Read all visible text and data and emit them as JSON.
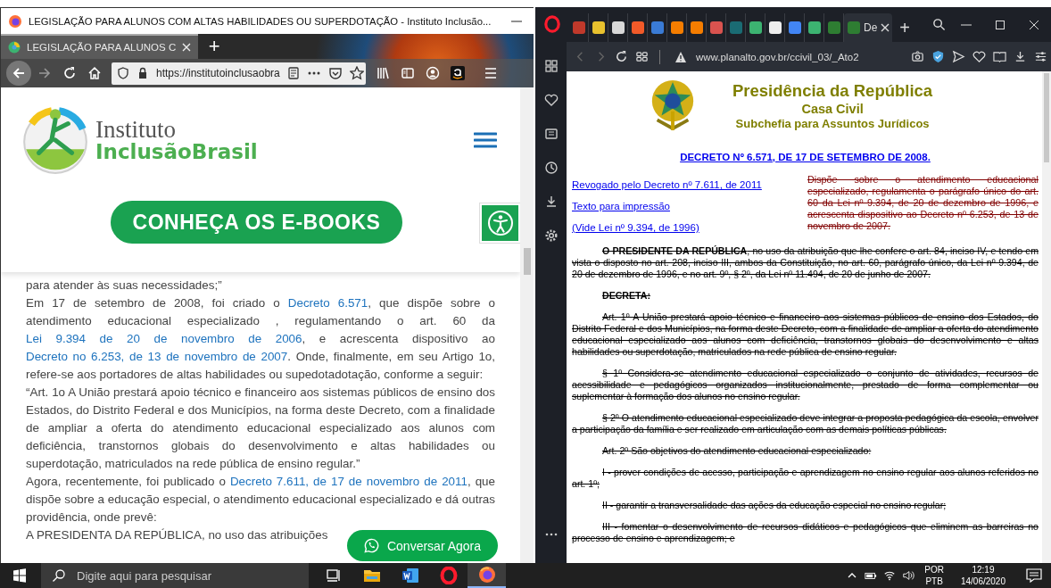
{
  "firefox": {
    "window_title": "LEGISLAÇÃO PARA ALUNOS COM ALTAS HABILIDADES OU SUPERDOTAÇÃO - Instituto Inclusão...",
    "tabs": [
      {
        "title": "LEGISLAÇÃO PARA ALUNOS C",
        "selected": true
      }
    ],
    "new_tab": "+",
    "url": "https://institutoinclusaobra",
    "site": {
      "logo_top": "Instituto",
      "logo_bottom": "InclusãoBrasil",
      "cta": "CONHEÇA OS E-BOOKS",
      "chat_button": "Conversar Agora",
      "paragraphs": [
        {
          "segments": [
            {
              "kind": "text",
              "text": "para atender às suas necessidades;”"
            }
          ]
        },
        {
          "segments": [
            {
              "kind": "text",
              "text": "Em 17 de setembro de 2008, foi criado o "
            },
            {
              "kind": "link",
              "text": "Decreto 6.571"
            },
            {
              "kind": "text",
              "text": ", que dispõe sobre o atendimento educacional especializado , regulamentando o art. 60 da "
            },
            {
              "kind": "link",
              "text": "Lei 9.394 de 20 de novembro de 2006"
            },
            {
              "kind": "text",
              "text": ", e acrescenta dispositivo ao "
            },
            {
              "kind": "link",
              "text": "Decreto no 6.253, de 13 de novembro de 2007"
            },
            {
              "kind": "text",
              "text": ". Onde, finalmente, em seu Artigo 1o, refere-se aos portadores de altas habilidades ou supedotadotação, conforme a seguir:"
            }
          ]
        },
        {
          "segments": [
            {
              "kind": "text",
              "text": "“Art. 1o A União prestará apoio técnico e financeiro aos sistemas públicos de ensino dos Estados, do Distrito Federal e dos Municípios, na forma deste Decreto, com a finalidade de ampliar a oferta do atendimento educacional especializado aos alunos com deficiência, transtornos globais do desenvolvimento e altas habilidades ou superdotação, matriculados na rede pública de ensino regular.”"
            }
          ]
        },
        {
          "segments": [
            {
              "kind": "text",
              "text": "Agora, recentemente, foi publicado o "
            },
            {
              "kind": "link",
              "text": "Decreto 7.611, de 17 de novembro de 2011"
            },
            {
              "kind": "text",
              "text": ", que dispõe sobre a educação especial, o atendimento educacional especializado e dá outras providência, onde prevê:"
            }
          ]
        },
        {
          "segments": [
            {
              "kind": "text",
              "text": "A PRESIDENTA DA REPÚBLICA, no uso das atribuições"
            }
          ]
        }
      ]
    }
  },
  "opera": {
    "tabs": [
      {
        "color": "#c0392b",
        "selected": false
      },
      {
        "color": "#e8c12e",
        "selected": false
      },
      {
        "color": "#d8d8d8",
        "selected": false
      },
      {
        "color": "#f15a29",
        "selected": false
      },
      {
        "color": "#3a7bd5",
        "selected": false
      },
      {
        "color": "#f57d00",
        "selected": false
      },
      {
        "color": "#f57d00",
        "selected": false
      },
      {
        "color": "#d9534f",
        "selected": false
      },
      {
        "color": "#1a6b73",
        "selected": false
      },
      {
        "color": "#3cb371",
        "selected": false
      },
      {
        "color": "#eeeeee",
        "selected": false
      },
      {
        "color": "#4285f4",
        "selected": false
      },
      {
        "color": "#3cb371",
        "selected": false
      },
      {
        "color": "#2e7d32",
        "selected": false
      },
      {
        "color": "#2e7d32",
        "selected": true,
        "label": "De"
      }
    ],
    "new_tab": "+",
    "url": "www.planalto.gov.br/ccivil_03/_Ato2",
    "page": {
      "header": {
        "title": "Presidência da República",
        "subtitle": "Casa Civil",
        "unit": "Subchefia para Assuntos Jurídicos"
      },
      "decree_title": "DECRETO Nº 6.571, DE 17 DE SETEMBRO DE 2008.",
      "side_links": [
        "Revogado pelo Decreto nº 7.611, de 2011",
        "Texto para impressão",
        "(Vide Lei nº 9.394, de 1996)"
      ],
      "summary": {
        "text": "Dispõe sobre o atendimento educacional especializado, regulamenta o parágrafo único do art. 60 da Lei nº 9.394, de 20 de dezembro de 1996, e acrescenta dispositivo ao Decreto nº 6.253, de 13 de novembro de 2007.",
        "struck": true
      },
      "paragraphs": [
        {
          "kind": "body",
          "struck": true,
          "text": "**O PRESIDENTE DA REPÚBLICA**, no uso da atribuição que lhe confere o art. 84, inciso IV, e tendo em vista o disposto no art. 208, inciso III, ambos da Constituição, no art. 60, parágrafo único, da Lei nº 9.394, de 20 de dezembro de 1996, e no art. 9º, § 2º, da Lei nº 11.494, de 20 de junho de 2007."
        },
        {
          "kind": "heading",
          "struck": true,
          "text": "DECRETA:"
        },
        {
          "kind": "body",
          "struck": true,
          "text": "Art. 1º  A União prestará apoio técnico e financeiro aos sistemas públicos de ensino dos Estados, do Distrito Federal e dos Municípios, na forma deste Decreto, com a finalidade de ampliar a oferta do atendimento educacional especializado aos alunos com deficiência, transtornos globais do desenvolvimento e altas habilidades ou superdotação, matriculados na rede pública de ensino regular."
        },
        {
          "kind": "body",
          "struck": true,
          "text": "§ 1º  Considera-se atendimento educacional especializado o conjunto de atividades, recursos de acessibilidade e pedagógicos organizados institucionalmente, prestado de forma complementar ou suplementar à formação dos alunos no ensino regular."
        },
        {
          "kind": "body",
          "struck": true,
          "text": "§ 2º  O atendimento educacional especializado deve integrar a proposta pedagógica da escola, envolver a participação da família e ser realizado em articulação com as demais políticas públicas."
        },
        {
          "kind": "body",
          "struck": true,
          "text": "Art. 2º  São objetivos do atendimento educacional especializado:"
        },
        {
          "kind": "body",
          "struck": true,
          "text": "I - prover condições de acesso, participação e aprendizagem no ensino regular aos alunos referidos no art. 1º;"
        },
        {
          "kind": "body",
          "struck": true,
          "text": "II - garantir a transversalidade das ações da educação especial no ensino regular;"
        },
        {
          "kind": "body",
          "struck": true,
          "text": "III - fomentar o desenvolvimento de recursos didáticos e pedagógicos que eliminem as barreiras no processo de ensino e aprendizagem; e"
        }
      ]
    }
  },
  "taskbar": {
    "search": {
      "placeholder": "Digite aqui para pesquisar"
    },
    "apps": [
      {
        "kind": "taskview",
        "selected": false
      },
      {
        "kind": "explorer",
        "selected": false
      },
      {
        "kind": "word",
        "selected": false
      },
      {
        "kind": "opera",
        "selected": false
      },
      {
        "kind": "firefox",
        "selected": true
      }
    ],
    "language": [
      "POR",
      "PTB"
    ],
    "time": "12:19",
    "date": "14/06/2020"
  }
}
